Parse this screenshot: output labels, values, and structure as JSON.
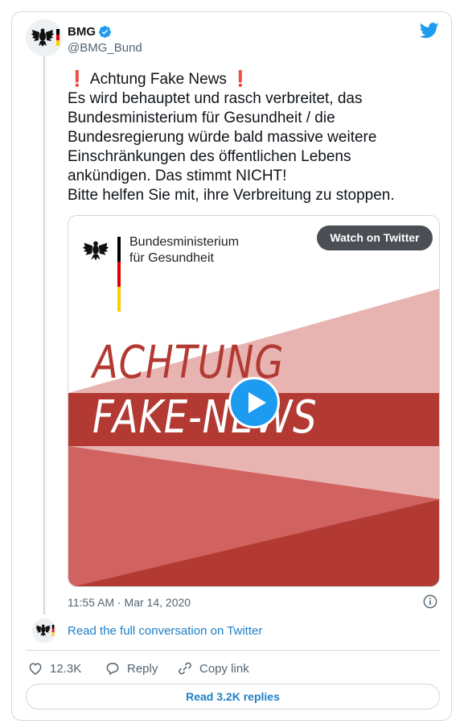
{
  "account": {
    "name": "BMG",
    "handle": "@BMG_Bund"
  },
  "tweet": {
    "lines": [
      "Achtung Fake News",
      "Es wird behauptet und rasch verbreitet, das",
      "Bundesministerium für Gesundheit / die",
      "Bundesregierung würde bald massive weitere",
      "Einschränkungen des öffentlichen Lebens",
      "ankündigen. Das stimmt NICHT!",
      "Bitte helfen Sie mit, ihre Verbreitung zu stoppen."
    ],
    "emoji": "❗",
    "timestamp": "11:55 AM · Mar 14, 2020"
  },
  "media": {
    "watch_label": "Watch on Twitter",
    "org_line1": "Bundesministerium",
    "org_line2": "für Gesundheit",
    "headline1": "ACHTUNG",
    "headline2": "FAKE-NEWS"
  },
  "conversation": {
    "read_full": "Read the full conversation on Twitter"
  },
  "actions": {
    "likes": "12.3K",
    "reply": "Reply",
    "copy_link": "Copy link"
  },
  "replies_button": "Read 3.2K replies",
  "colors": {
    "accent": "#1d9bf0",
    "link": "#1d7fc6",
    "media_red": "#b23a33",
    "media_pink": "#e7b4b1"
  },
  "icons": [
    "eagle-logo",
    "verified-badge-icon",
    "twitter-bird-icon",
    "play-icon",
    "info-icon",
    "heart-icon",
    "reply-bubble-icon",
    "link-icon"
  ]
}
